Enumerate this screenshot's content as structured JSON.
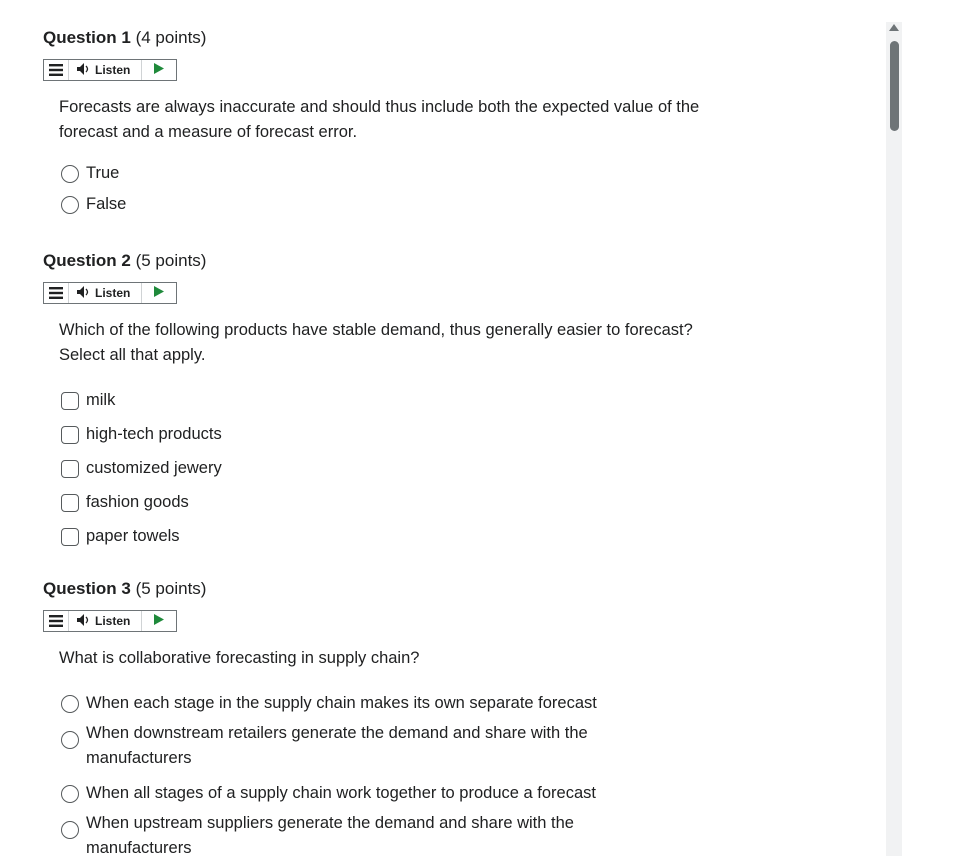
{
  "questions": [
    {
      "number": "Question 1",
      "points": "(4 points)",
      "listen_label": "Listen",
      "prompt": "Forecasts are always inaccurate and should thus include both the expected value of the forecast and a measure of forecast error.",
      "type": "radio",
      "options": [
        "True",
        "False"
      ]
    },
    {
      "number": "Question 2",
      "points": "(5 points)",
      "listen_label": "Listen",
      "prompt": "Which of the following products have stable demand, thus generally easier to forecast? Select all that apply.",
      "type": "checkbox",
      "options": [
        "milk",
        "high-tech products",
        "customized jewery",
        "fashion goods",
        "paper towels"
      ]
    },
    {
      "number": "Question 3",
      "points": "(5 points)",
      "listen_label": "Listen",
      "prompt": "What is collaborative forecasting in supply chain?",
      "type": "radio",
      "options": [
        "When each stage in the supply chain makes its own separate forecast",
        "When downstream retailers generate the demand and share with the manufacturers",
        "When all stages of a supply chain work together to produce a forecast",
        "When upstream suppliers generate the demand and share with the manufacturers"
      ]
    }
  ],
  "colors": {
    "play": "#1f8a3b",
    "icon": "#565a5c"
  },
  "icons": [
    "menu-icon",
    "speaker-icon",
    "play-icon",
    "scroll-up-arrow-icon"
  ]
}
